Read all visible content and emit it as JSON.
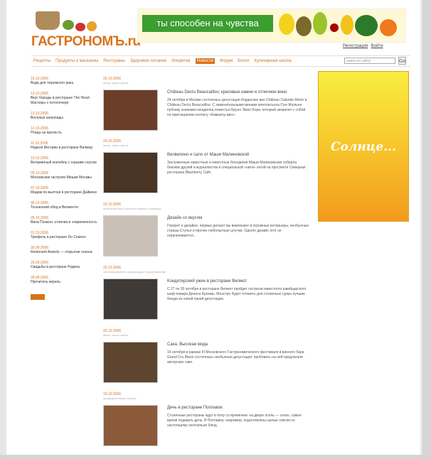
{
  "logo": {
    "title": "ГАСТРОНОМЪ.ru"
  },
  "banner": {
    "slogan": "ты способен на чувства"
  },
  "toplinks": {
    "register": "Регистрация",
    "login": "Войти"
  },
  "nav": {
    "items": [
      "Рецепты",
      "Продукты и магазины",
      "Рестораны",
      "Здоровое питание",
      "Аперитив",
      "Новости",
      "Форум",
      "Блоги",
      "Кулинарная школа"
    ],
    "active_index": 5,
    "search_placeholder": "поиск по сайту",
    "search_button": "Go"
  },
  "news": [
    {
      "date": "16.10.2006",
      "title": "Вода для тюремного рака"
    },
    {
      "date": "13.10.2006",
      "title": "Вкус бороды в ресторане The Heart. Мастиры о потолочере"
    },
    {
      "date": "13.10.2006",
      "title": "Веселые шоколады"
    },
    {
      "date": "12.10.2006",
      "title": "Птица на прелесть"
    },
    {
      "date": "11.10.2006",
      "title": "Неделя Вестрии в ресторане Вилмор"
    },
    {
      "date": "10.10.2006",
      "title": "Витаминный коктейль с горьким соусом"
    },
    {
      "date": "09.10.2006",
      "title": "Московские гастроли Мишки Москвы"
    },
    {
      "date": "07.10.2006",
      "title": "Мадам по-вьетски в ресторане Дайкини"
    },
    {
      "date": "06.10.2006",
      "title": "Тосканский обед в Вилмонте"
    },
    {
      "date": "05.10.2006",
      "title": "Вина Пэнмэн: отличия и современность"
    },
    {
      "date": "01.10.2006",
      "title": "Трюфель в ресторане Do Ceanon"
    },
    {
      "date": "30.09.2006",
      "title": "Restoranti Awards — открытая сезона"
    },
    {
      "date": "29.09.2006",
      "title": "Свадьбы в ресторане Родина"
    },
    {
      "date": "28.09.2006",
      "title": "Прочитать апрель"
    }
  ],
  "articles": [
    {
      "date": "25.10.2006",
      "sub": "автор: пресс-релиз",
      "head": "Château Dectu Beaucaillou: красивые камни и отличное вино",
      "text": "24 октября в Москве состоялась дегустация бордоских вин Château Calonde-Morin и Château Dectu Beaucaillou. С замечательными винами апелласьона Сен-Жюльен публику знакомил владелец поместья Бруно Эжен Бори, который захватил с собой по приглашению коллегу «Камнеты вин».",
      "img": "#6b3e2a"
    },
    {
      "date": "24.10.2006",
      "sub": "автор: пресс-релиз",
      "head": "Велвелино и сало от Маши Малиновской",
      "text": "Заслуженные известные и известные блондинки Маши Малиновская собрала близких друзей и журналистов в специальной «нити» ногой на проспекте Северная ресторана Blackberry Café.",
      "img": "#4a3424"
    },
    {
      "date": "23.10.2006",
      "sub": "пятилетие фото проекта главных сокровищ",
      "head": "Дизайн со вкусом",
      "text": "Говорят о дизайне, первые делают вы вовлекают в огромные интерьеры, необычные стразы-Стулья и прочее любопытные штучки. Одного дизайн этот не ограничивается...",
      "img": "#c9c0b8"
    },
    {
      "date": "22.10.2006",
      "sub": "запланированное сокровищное представление",
      "head": "Кондитерский ужин в ресторане Вилмот",
      "text": "С 27 по 30 октября в ресторане Вилмот пройдет гастроли известного швейцарского шеф-повара Дениса Букомы. Маэстро будет готовить для столичных гурмэ лучшие блюда из новой своей дегустации.",
      "img": "#3d3a37"
    },
    {
      "date": "20.10.2006",
      "sub": "автор: пресс-релиз",
      "head": "Сака. Высокая мода",
      "text": "16 октября в рамках III Московского Гастрономического фестиваля в винного бара Grand Cru Black состоялась необычная дегустация: пробовать на ней предлагали авторские саке.",
      "img": "#5e4530"
    },
    {
      "date": "19.10.2006",
      "sub": "предварительная версия",
      "head": "Дичь в ресторане Поплавок",
      "text": "Столичные рестораны ждут в полу со временем: на дворе осень — сезон, самое время подавать дичь. В Поплавок, например, подготовлены целые списки по настоящему охотничьих блюд.",
      "img": "#8a5a3a"
    }
  ],
  "ad": {
    "text": "Солнце..."
  }
}
